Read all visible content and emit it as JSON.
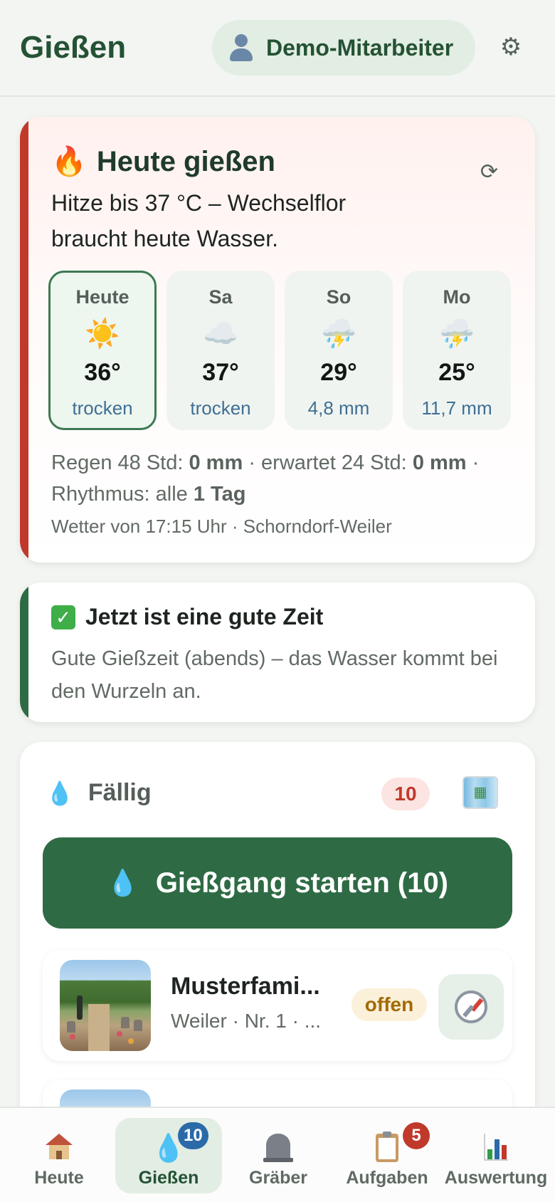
{
  "header": {
    "title": "Gießen",
    "user_name": "Demo-Mitarbeiter",
    "user_icon": "user-icon",
    "settings_icon": "gear-icon"
  },
  "heat_card": {
    "icon": "🔥",
    "title": "Heute gießen",
    "description": "Hitze bis 37 °C – Wechselflor braucht heute Wasser.",
    "refresh_icon": "⟳",
    "days": [
      {
        "label": "Heute",
        "icon": "☀️",
        "temp": "36°",
        "rain": "trocken",
        "active": true
      },
      {
        "label": "Sa",
        "icon": "☁️",
        "temp": "37°",
        "rain": "trocken",
        "active": false
      },
      {
        "label": "So",
        "icon": "⛈️",
        "temp": "29°",
        "rain": "4,8 mm",
        "active": false
      },
      {
        "label": "Mo",
        "icon": "⛈️",
        "temp": "25°",
        "rain": "11,7 mm",
        "active": false
      }
    ],
    "rain_48_label": "Regen 48 Std:",
    "rain_48_value": "0 mm",
    "rain_24_label": "· erwartet 24 Std:",
    "rain_24_value": "0 mm",
    "rhythm_label": "· Rhythmus: alle",
    "rhythm_value": "1 Tag",
    "weather_meta": "Wetter von 17:15 Uhr · Schorndorf-Weiler"
  },
  "good_time_card": {
    "icon": "✓",
    "title": "Jetzt ist eine gute Zeit",
    "description": "Gute Gießzeit (abends) – das Wasser kommt bei den Wurzeln an."
  },
  "due_section": {
    "icon": "💧",
    "title": "Fällig",
    "count": "10",
    "map_icon": "map-icon",
    "start_button_label": "Gießgang starten (10)",
    "graves": [
      {
        "name": "Musterfami...",
        "location": "Weiler · Nr. 1 · ...",
        "status": "offen"
      }
    ]
  },
  "bottom_nav": [
    {
      "label": "Heute",
      "icon": "house-icon",
      "badge": ""
    },
    {
      "label": "Gießen",
      "icon": "droplet-icon",
      "badge": "10"
    },
    {
      "label": "Gräber",
      "icon": "headstone-icon",
      "badge": ""
    },
    {
      "label": "Aufgaben",
      "icon": "clipboard-icon",
      "badge": "5"
    },
    {
      "label": "Auswertung",
      "icon": "chart-icon",
      "badge": ""
    }
  ],
  "colors": {
    "brand_green": "#2e6b44",
    "alert_red": "#c0392b",
    "rain_blue": "#3e6f94",
    "status_orange": "#a36a05"
  }
}
